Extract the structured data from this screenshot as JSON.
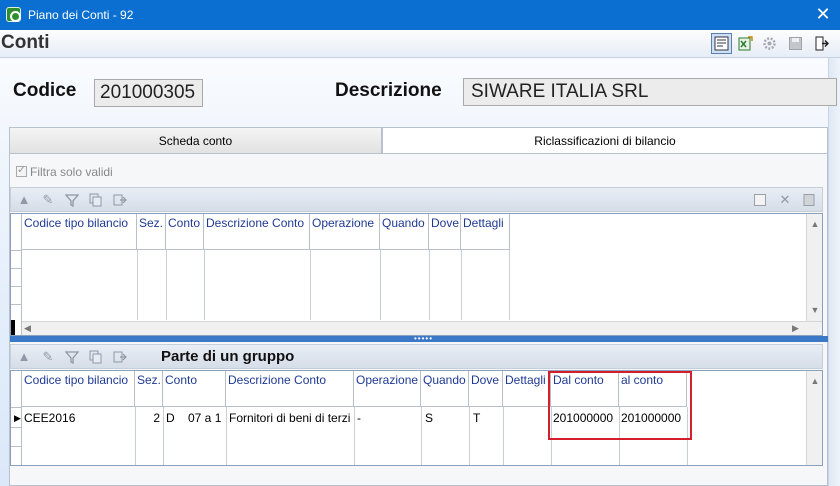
{
  "window": {
    "title": "Piano dei Conti - 92",
    "close_glyph": "✕"
  },
  "header": {
    "title": "Conti",
    "toolbar_icons": [
      "properties-icon",
      "export-excel-icon",
      "settings-icon",
      "save-icon",
      "exit-icon"
    ]
  },
  "account": {
    "codice_label": "Codice",
    "codice_value": "201000305",
    "descrizione_label": "Descrizione",
    "descrizione_value": "SIWARE ITALIA SRL"
  },
  "tabs": [
    {
      "label": "Scheda conto",
      "active": false
    },
    {
      "label": "Riclassificazioni di bilancio",
      "active": true
    }
  ],
  "filter": {
    "label": "Filtra solo validi",
    "checked": true,
    "enabled": false
  },
  "grid1": {
    "columns": [
      "Codice tipo bilancio",
      "Sez.",
      "Conto",
      "Descrizione Conto",
      "Operazione",
      "Quando",
      "Dove",
      "Dettagli"
    ],
    "rows": []
  },
  "grid2": {
    "title": "Parte di un gruppo",
    "columns": [
      "Codice tipo bilancio",
      "Sez.",
      "Conto",
      "Descrizione Conto",
      "Operazione",
      "Quando",
      "Dove",
      "Dettagli",
      "Dal conto",
      "al conto"
    ],
    "rows": [
      {
        "codice": "CEE2016",
        "sez": "2",
        "conto": "D    07 a 1",
        "descrizione": "Fornitori di beni di terzi",
        "operazione": "-",
        "quando": "S",
        "dove": "T",
        "dettagli": "",
        "dal": "201000000",
        "al": "201000000"
      }
    ]
  },
  "colors": {
    "titlebar": "#0a6fd1",
    "header_text": "#1f3a93",
    "highlight": "#d21f2b",
    "splitter": "#3c78c8"
  }
}
